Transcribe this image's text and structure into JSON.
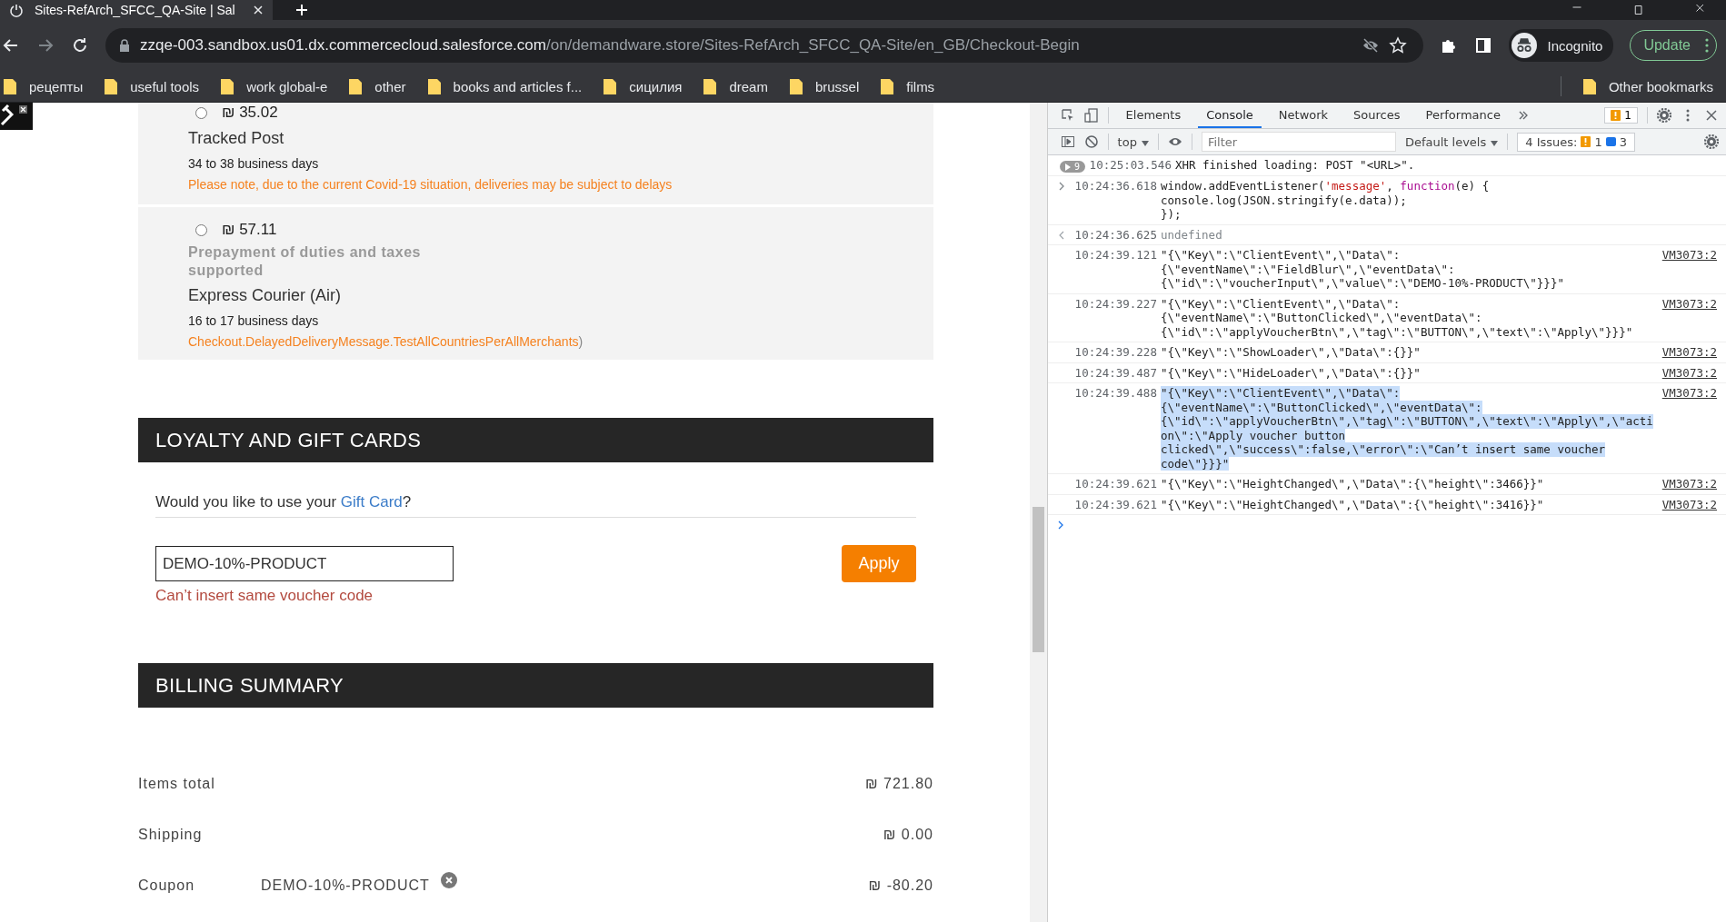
{
  "browser": {
    "tab_title": "Sites-RefArch_SFCC_QA-Site | Sal",
    "url_host": "zzqe-003.sandbox.us01.dx.commercecloud.salesforce.com",
    "url_path": "/on/demandware.store/Sites-RefArch_SFCC_QA-Site/en_GB/Checkout-Begin",
    "profile": "Incognito",
    "update_button": "Update",
    "bookmarks": [
      "рецепты",
      "useful tools",
      "work global-e",
      "other",
      "books and articles f...",
      "сицилия",
      "dream",
      "brussel",
      "films"
    ],
    "other_bookmarks": "Other bookmarks"
  },
  "shipping_options": [
    {
      "selected": false,
      "price": "₪ 35.02",
      "name": "Tracked Post",
      "days": "34 to 38 business days",
      "message": "Please note, due to the current Covid-19 situation, deliveries may be subject to delays"
    },
    {
      "selected": false,
      "price": "₪ 57.11",
      "note": "Prepayment of duties and taxes supported",
      "name": "Express Courier (Air)",
      "days": "16 to 17 business days",
      "message": "Checkout.DelayedDeliveryMessage.TestAllCountriesPerAllMerchants",
      "message_tail": ")"
    }
  ],
  "loyalty": {
    "heading": "LOYALTY AND GIFT CARDS",
    "question_before": "Would you like to use your ",
    "question_link": "Gift Card",
    "question_after": "?",
    "voucher_value": "DEMO-10%-PRODUCT",
    "apply_button": "Apply",
    "error": "Can’t insert same voucher code"
  },
  "billing": {
    "heading": "BILLING SUMMARY",
    "rows": [
      {
        "label": "Items total",
        "amount": "₪ 721.80"
      },
      {
        "label": "Shipping",
        "amount": "₪ 0.00"
      },
      {
        "label": "Coupon",
        "code": "DEMO-10%-PRODUCT",
        "amount": "₪ -80.20"
      }
    ]
  },
  "devtools": {
    "tabs": [
      {
        "label": "Elements",
        "selected": false
      },
      {
        "label": "Console",
        "selected": true
      },
      {
        "label": "Network",
        "selected": false
      },
      {
        "label": "Sources",
        "selected": false
      },
      {
        "label": "Performance",
        "selected": false
      }
    ],
    "issues_badge": "1",
    "context": "top",
    "filter_placeholder": "Filter",
    "levels": "Default levels",
    "issues_label": "4 Issues:",
    "issues_warnings": "1",
    "issues_info": "3",
    "messages": [
      {
        "kind": "group",
        "count": "9",
        "time": "10:25:03.546",
        "selected": false,
        "lines": [
          [
            {
              "t": "XHR finished loading: POST \"<URL>\"."
            }
          ]
        ]
      },
      {
        "kind": "input",
        "time": "10:24:36.618",
        "selected": false,
        "lines": [
          [
            {
              "t": "window.addEventListener("
            },
            {
              "t": "'message'",
              "kind": "string"
            },
            {
              "t": ", "
            },
            {
              "t": "function",
              "kind": "keyword"
            },
            {
              "t": "(e) {"
            }
          ],
          [
            {
              "t": "console.log(JSON.stringify(e.data));"
            }
          ],
          [
            {
              "t": "});"
            }
          ]
        ]
      },
      {
        "kind": "result",
        "time": "10:24:36.625",
        "selected": false,
        "lines": [
          [
            {
              "t": "undefined",
              "kind": "muted"
            }
          ]
        ]
      },
      {
        "kind": "log",
        "time": "10:24:39.121",
        "selected": false,
        "source": "VM3073:2",
        "lines": [
          [
            {
              "t": "\"{\\\"Key\\\":\\\"ClientEvent\\\",\\\"Data\\\":"
            }
          ],
          [
            {
              "t": "{\\\"eventName\\\":\\\"FieldBlur\\\",\\\"eventData\\\":"
            }
          ],
          [
            {
              "t": "{\\\"id\\\":\\\"voucherInput\\\",\\\"value\\\":\\\"DEMO-10%-PRODUCT\\\"}}}\""
            }
          ]
        ]
      },
      {
        "kind": "log",
        "time": "10:24:39.227",
        "selected": false,
        "source": "VM3073:2",
        "lines": [
          [
            {
              "t": "\"{\\\"Key\\\":\\\"ClientEvent\\\",\\\"Data\\\":"
            }
          ],
          [
            {
              "t": "{\\\"eventName\\\":\\\"ButtonClicked\\\",\\\"eventData\\\":"
            }
          ],
          [
            {
              "t": "{\\\"id\\\":\\\"applyVoucherBtn\\\",\\\"tag\\\":\\\"BUTTON\\\",\\\"text\\\":\\\"Apply\\\"}}}\""
            }
          ]
        ]
      },
      {
        "kind": "log",
        "time": "10:24:39.228",
        "selected": false,
        "source": "VM3073:2",
        "lines": [
          [
            {
              "t": "\"{\\\"Key\\\":\\\"ShowLoader\\\",\\\"Data\\\":{}}\""
            }
          ]
        ]
      },
      {
        "kind": "log",
        "time": "10:24:39.487",
        "selected": false,
        "source": "VM3073:2",
        "lines": [
          [
            {
              "t": "\"{\\\"Key\\\":\\\"HideLoader\\\",\\\"Data\\\":{}}\""
            }
          ]
        ]
      },
      {
        "kind": "log",
        "time": "10:24:39.488",
        "selected": true,
        "source": "VM3073:2",
        "lines": [
          [
            {
              "t": "\"{\\\"Key\\\":\\\"ClientEvent\\\",\\\"Data\\\":"
            }
          ],
          [
            {
              "t": "{\\\"eventName\\\":\\\"ButtonClicked\\\",\\\"eventData\\\":"
            }
          ],
          [
            {
              "t": "{\\\"id\\\":\\\"applyVoucherBtn\\\",\\\"tag\\\":\\\"BUTTON\\\",\\\"text\\\":\\\"Apply\\\",\\\"acti"
            }
          ],
          [
            {
              "t": "on\\\":\\\"Apply voucher button"
            }
          ],
          [
            {
              "t": "clicked\\\",\\\"success\\\":false,\\\"error\\\":\\\"Can’t insert same voucher"
            }
          ],
          [
            {
              "t": "code\\\"}}}\""
            }
          ]
        ]
      },
      {
        "kind": "log",
        "time": "10:24:39.621",
        "selected": false,
        "source": "VM3073:2",
        "lines": [
          [
            {
              "t": "\"{\\\"Key\\\":\\\"HeightChanged\\\",\\\"Data\\\":{\\\"height\\\":3466}}\""
            }
          ]
        ]
      },
      {
        "kind": "log",
        "time": "10:24:39.621",
        "selected": false,
        "source": "VM3073:2",
        "lines": [
          [
            {
              "t": "\"{\\\"Key\\\":\\\"HeightChanged\\\",\\\"Data\\\":{\\\"height\\\":3416}}\""
            }
          ]
        ]
      }
    ]
  }
}
